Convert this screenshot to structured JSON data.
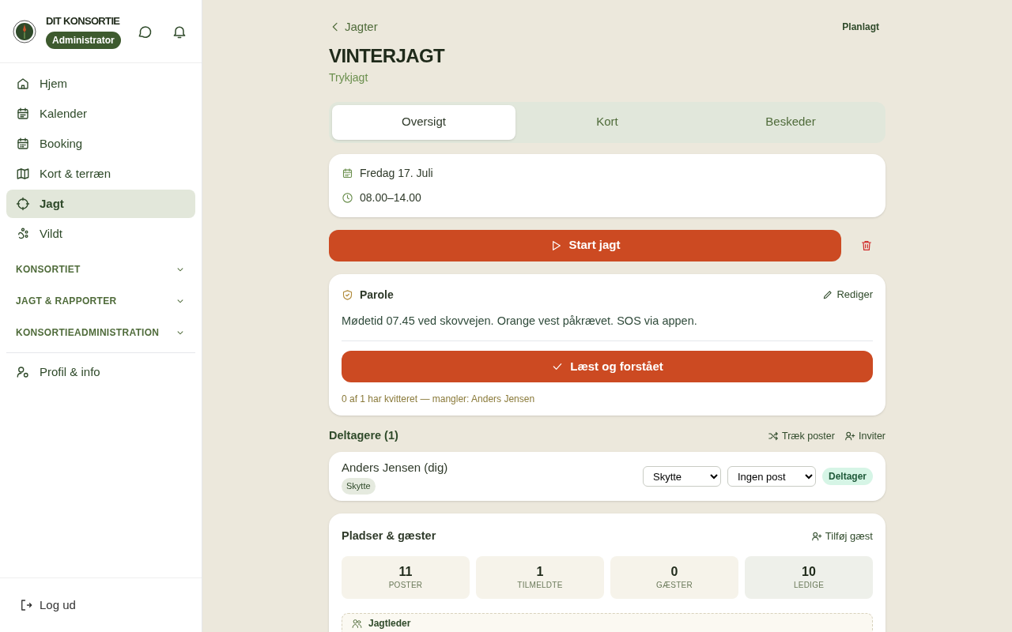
{
  "sidebar": {
    "brand": "DIT KONSORTIE",
    "role": "Administrator",
    "items": [
      {
        "label": "Hjem",
        "selected": false
      },
      {
        "label": "Kalender",
        "selected": false
      },
      {
        "label": "Booking",
        "selected": false
      },
      {
        "label": "Kort & terræn",
        "selected": false
      },
      {
        "label": "Jagt",
        "selected": true
      },
      {
        "label": "Vildt",
        "selected": false
      }
    ],
    "sections": [
      {
        "label": "KONSORTIET",
        "expanded": false
      },
      {
        "label": "JAGT & RAPPORTER",
        "expanded": false
      },
      {
        "label": "KONSORTIEADMINISTRATION",
        "expanded": false
      }
    ],
    "profile": "Profil & info",
    "logout": "Log ud"
  },
  "header": {
    "back": "Jagter",
    "status": "Planlagt",
    "title": "VINTERJAGT",
    "subtitle": "Trykjagt"
  },
  "tabs": [
    {
      "label": "Oversigt",
      "selected": true
    },
    {
      "label": "Kort",
      "selected": false
    },
    {
      "label": "Beskeder",
      "selected": false
    }
  ],
  "schedule": {
    "date": "Fredag 17. Juli",
    "time": "08.00–14.00"
  },
  "start_button": "Start jagt",
  "parole": {
    "title": "Parole",
    "edit": "Rediger",
    "text": "Mødetid 07.45 ved skovvejen. Orange vest påkrævet. SOS via appen.",
    "confirm": "Læst og forstået",
    "receipt": "0 af 1 har kvitteret — mangler: Anders Jensen"
  },
  "participants": {
    "title": "Deltagere (1)",
    "draw": "Træk poster",
    "invite": "Inviter",
    "rows": [
      {
        "name": "Anders Jensen (dig)",
        "tag": "Skytte",
        "role": "Skytte",
        "post": "Ingen post",
        "status": "Deltager"
      }
    ]
  },
  "places": {
    "title": "Pladser & gæster",
    "add_guest": "Tilføj gæst",
    "stats": [
      {
        "value": "11",
        "label": "POSTER",
        "kind": "count"
      },
      {
        "value": "1",
        "label": "TILMELDTE",
        "kind": "count"
      },
      {
        "value": "0",
        "label": "GÆSTER",
        "kind": "count"
      },
      {
        "value": "10",
        "label": "LEDIGE",
        "kind": "free"
      }
    ],
    "leader": "Jagtleder"
  }
}
